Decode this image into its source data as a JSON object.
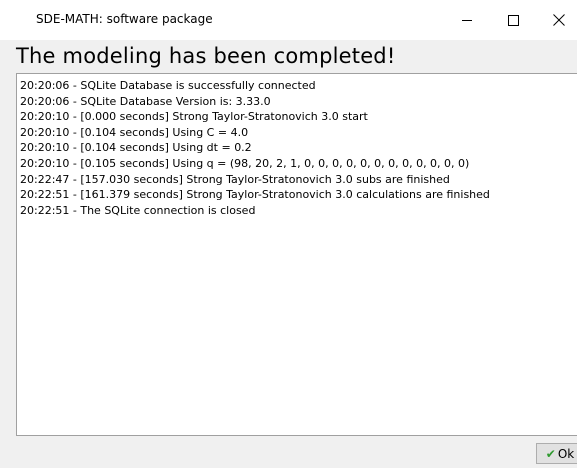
{
  "window": {
    "title": "SDE-MATH: software package",
    "controls": {
      "minimize_icon": "minimize-icon",
      "maximize_icon": "maximize-icon",
      "close_icon": "close-icon"
    }
  },
  "heading": "The modeling has been completed!",
  "log": [
    "20:20:06 - SQLite Database is successfully connected",
    "20:20:06 - SQLite Database Version is: 3.33.0",
    "20:20:10 - [0.000 seconds] Strong Taylor-Stratonovich 3.0 start",
    "20:20:10 - [0.104 seconds] Using C = 4.0",
    "20:20:10 - [0.104 seconds] Using dt = 0.2",
    "20:20:10 - [0.105 seconds] Using q = (98, 20, 2, 1, 0, 0, 0, 0, 0, 0, 0, 0, 0, 0, 0, 0)",
    "20:22:47 - [157.030 seconds] Strong Taylor-Stratonovich 3.0 subs are finished",
    "20:22:51 - [161.379 seconds] Strong Taylor-Stratonovich 3.0 calculations are finished",
    "20:22:51 - The SQLite connection is closed"
  ],
  "ok_button": {
    "label": "Ok",
    "icon": "check-icon",
    "icon_color": "#2e9a2e"
  }
}
